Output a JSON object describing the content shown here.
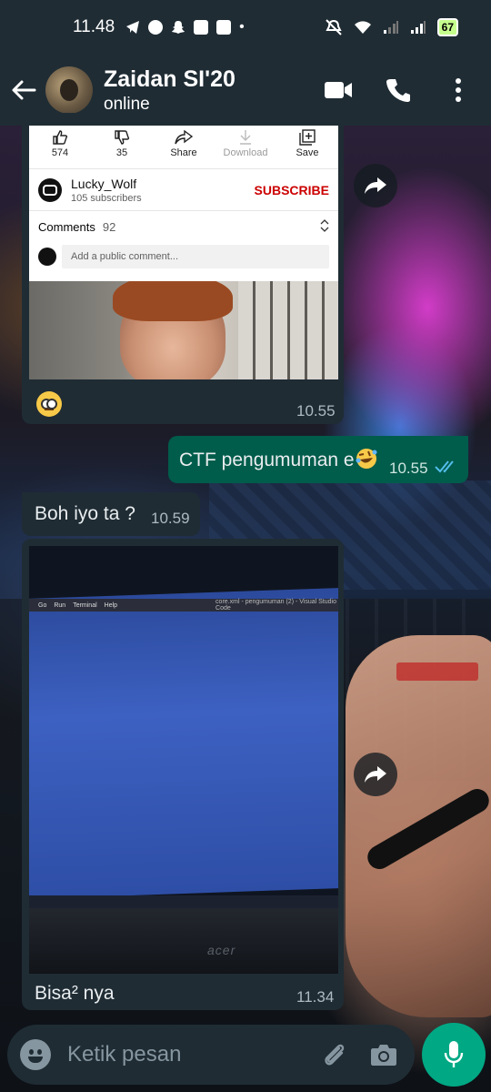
{
  "status_bar": {
    "time": "11.48",
    "battery": "67",
    "dot": "•"
  },
  "header": {
    "contact_name": "Zaidan SI'20",
    "contact_status": "online",
    "icons": [
      "back-arrow-icon",
      "video-call-icon",
      "voice-call-icon",
      "more-menu-icon"
    ]
  },
  "messages": [
    {
      "type": "incoming-link-preview",
      "youtube": {
        "actions": [
          {
            "label": "574",
            "icon": "thumb-up-icon"
          },
          {
            "label": "35",
            "icon": "thumb-down-icon"
          },
          {
            "label": "Share",
            "icon": "share-icon"
          },
          {
            "label": "Download",
            "icon": "download-icon"
          },
          {
            "label": "Save",
            "icon": "save-playlist-icon"
          }
        ],
        "channel_name": "Lucky_Wolf",
        "subscribers": "105 subscribers",
        "subscribe_label": "SUBSCRIBE",
        "comments_label": "Comments",
        "comments_count": "92",
        "comment_placeholder": "Add a public comment..."
      },
      "caption_emoji": "face-with-rolling-eyes",
      "time": "10.55"
    },
    {
      "type": "outgoing-text",
      "text": "CTF pengumuman e",
      "emoji": "face-with-tears-of-joy-sideways",
      "time": "10.55",
      "ticks": "read"
    },
    {
      "type": "incoming-text",
      "text": "Boh iyo ta ?",
      "time": "10.59"
    },
    {
      "type": "incoming-image",
      "photo": {
        "menu": [
          "Go",
          "Run",
          "Terminal",
          "Help"
        ],
        "window_title": "core.xml - pengumuman (2) - Visual Studio Code",
        "brand": "acer"
      },
      "caption": "Bisa² nya",
      "time": "11.34"
    }
  ],
  "input_bar": {
    "placeholder": "Ketik pesan"
  },
  "colors": {
    "header_bg": "#1f2c34",
    "incoming_bubble": "#1f2c34",
    "outgoing_bubble": "#005c4b",
    "accent": "#00a884",
    "subscribe_red": "#cc0000",
    "read_tick": "#53bdeb"
  }
}
